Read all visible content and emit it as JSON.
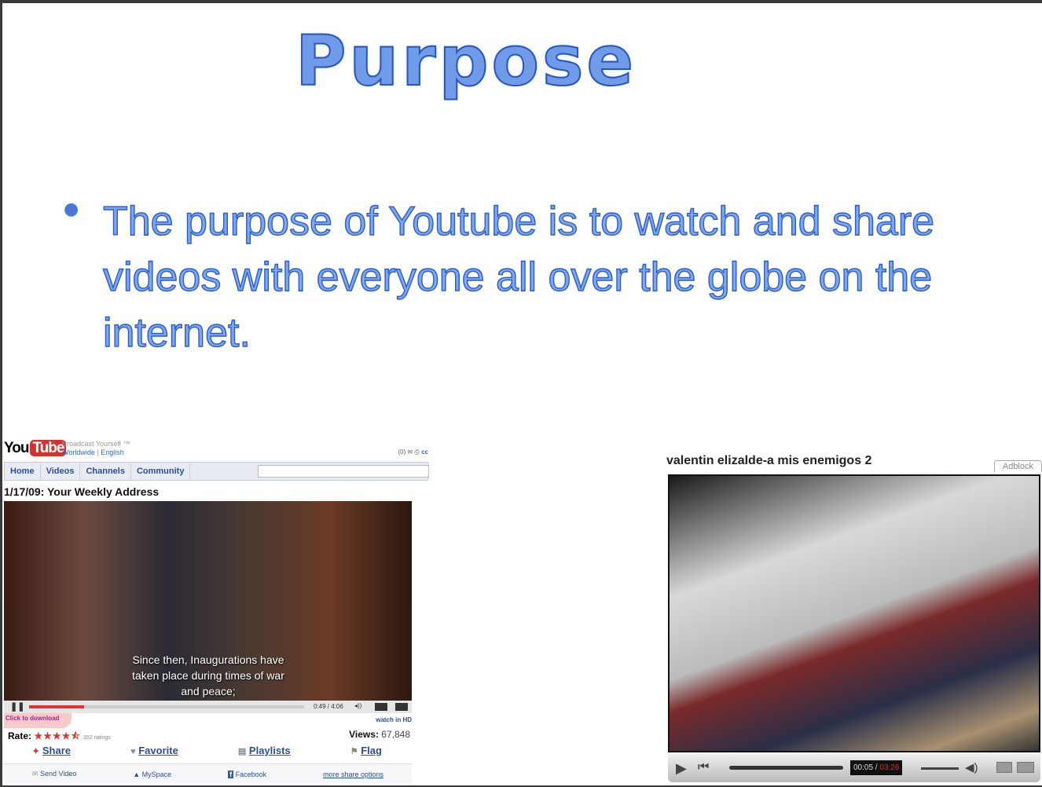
{
  "slide": {
    "title": "Purpose",
    "bullet": "The purpose of Youtube is to watch and share videos with everyone all over the globe on the internet."
  },
  "left_screenshot": {
    "logo": {
      "you": "You",
      "tube": "Tube"
    },
    "tagline": "Broadcast Yourself ™",
    "region": "Worldwide",
    "language": "English",
    "top_right": "(0)",
    "top_right_link": "cc",
    "nav": [
      "Home",
      "Videos",
      "Channels",
      "Community"
    ],
    "video_title": "1/17/09: Your Weekly Address",
    "caption": [
      "Since then, Inaugurations have",
      "taken place during times of war",
      "and peace;"
    ],
    "time": "0:49 / 4:06",
    "progress_percent": 20,
    "click_to_download": "Click to download",
    "watch_hd": "watch in HD",
    "rate_label": "Rate:",
    "stars": "★★★★⯪",
    "rating_value": 4.5,
    "ratings": "352 ratings",
    "views_label": "Views:",
    "views": "67,848",
    "actions": [
      "Share",
      "Favorite",
      "Playlists",
      "Flag"
    ],
    "share_options": [
      "Send Video",
      "MySpace",
      "Facebook",
      "more share options"
    ]
  },
  "right_screenshot": {
    "video_title": "valentin elizalde-a mis enemigos 2",
    "adblock": "Adblock",
    "time_current": "00:05 / ",
    "time_total": "03:26",
    "progress_percent": 2.5
  }
}
